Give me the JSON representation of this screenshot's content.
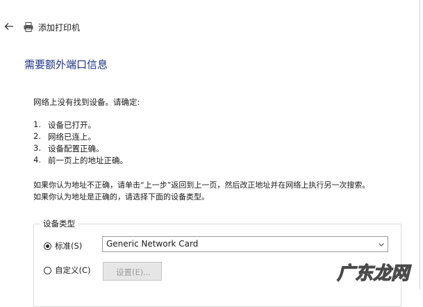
{
  "window": {
    "title": "添加打印机"
  },
  "icons": {
    "back": "back-arrow-icon",
    "printer": "printer-icon",
    "chevron": "chevron-down-icon"
  },
  "page": {
    "heading": "需要额外端口信息",
    "intro": "网络上没有找到设备。请确定:",
    "checklist": [
      {
        "num": "1.",
        "text": "设备已打开。"
      },
      {
        "num": "2.",
        "text": "网络已连上。"
      },
      {
        "num": "3.",
        "text": "设备配置正确。"
      },
      {
        "num": "4.",
        "text": "前一页上的地址正确。"
      }
    ],
    "note_line1": "如果你认为地址不正确，请单击“上一步”返回到上一页，然后改正地址并在网络上执行另一次搜索。",
    "note_line2": "如果你认为地址是正确的，请选择下面的设备类型。"
  },
  "device_type": {
    "group_label": "设备类型",
    "standard_label": "标准(S)",
    "standard_selected": true,
    "standard_value": "Generic Network Card",
    "custom_label": "自定义(C)",
    "custom_selected": false,
    "settings_button": "设置(E)..."
  },
  "watermark": {
    "text": "广东龙网"
  },
  "colors": {
    "heading": "#1e3287",
    "watermark": "#4a4a4a"
  }
}
